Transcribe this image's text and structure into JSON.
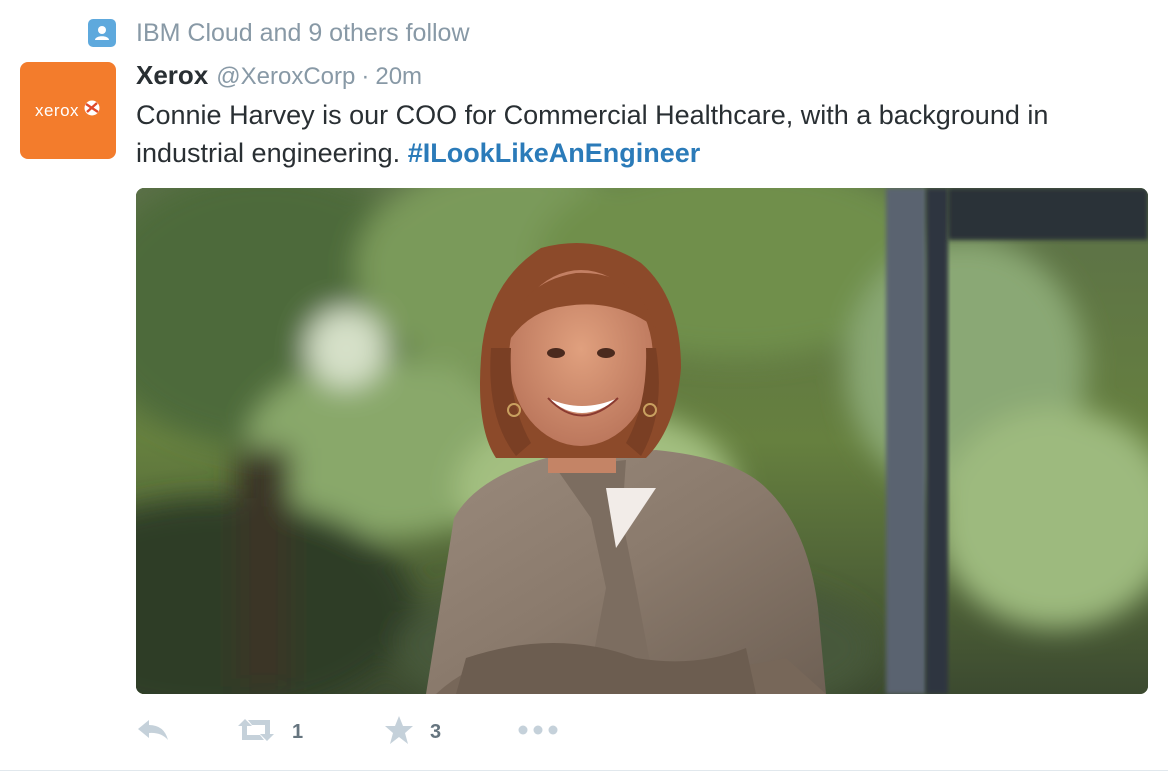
{
  "context": {
    "icon": "person-icon",
    "text": "IBM Cloud and 9 others follow"
  },
  "author": {
    "avatar_text": "xerox",
    "avatar_color": "#f37c2c",
    "name": "Xerox",
    "handle": "@XeroxCorp",
    "separator": "·",
    "time": "20m"
  },
  "tweet": {
    "text": "Connie Harvey is our COO for Commercial Healthcare, with a background in industrial engineering. ",
    "hashtag": "#ILookLikeAnEngineer",
    "hashtag_color": "#2b7bb9"
  },
  "media": {
    "icon": "photo-of-woman-in-gray-blazer"
  },
  "actions": {
    "reply": {
      "icon": "reply-icon"
    },
    "retweet": {
      "icon": "retweet-icon",
      "count": "1"
    },
    "favorite": {
      "icon": "star-icon",
      "count": "3"
    },
    "more": {
      "icon": "more-dots-icon"
    }
  },
  "colors": {
    "secondary_text": "#8899a6",
    "primary_text": "#292f33",
    "action_icon": "#c5d1da"
  }
}
